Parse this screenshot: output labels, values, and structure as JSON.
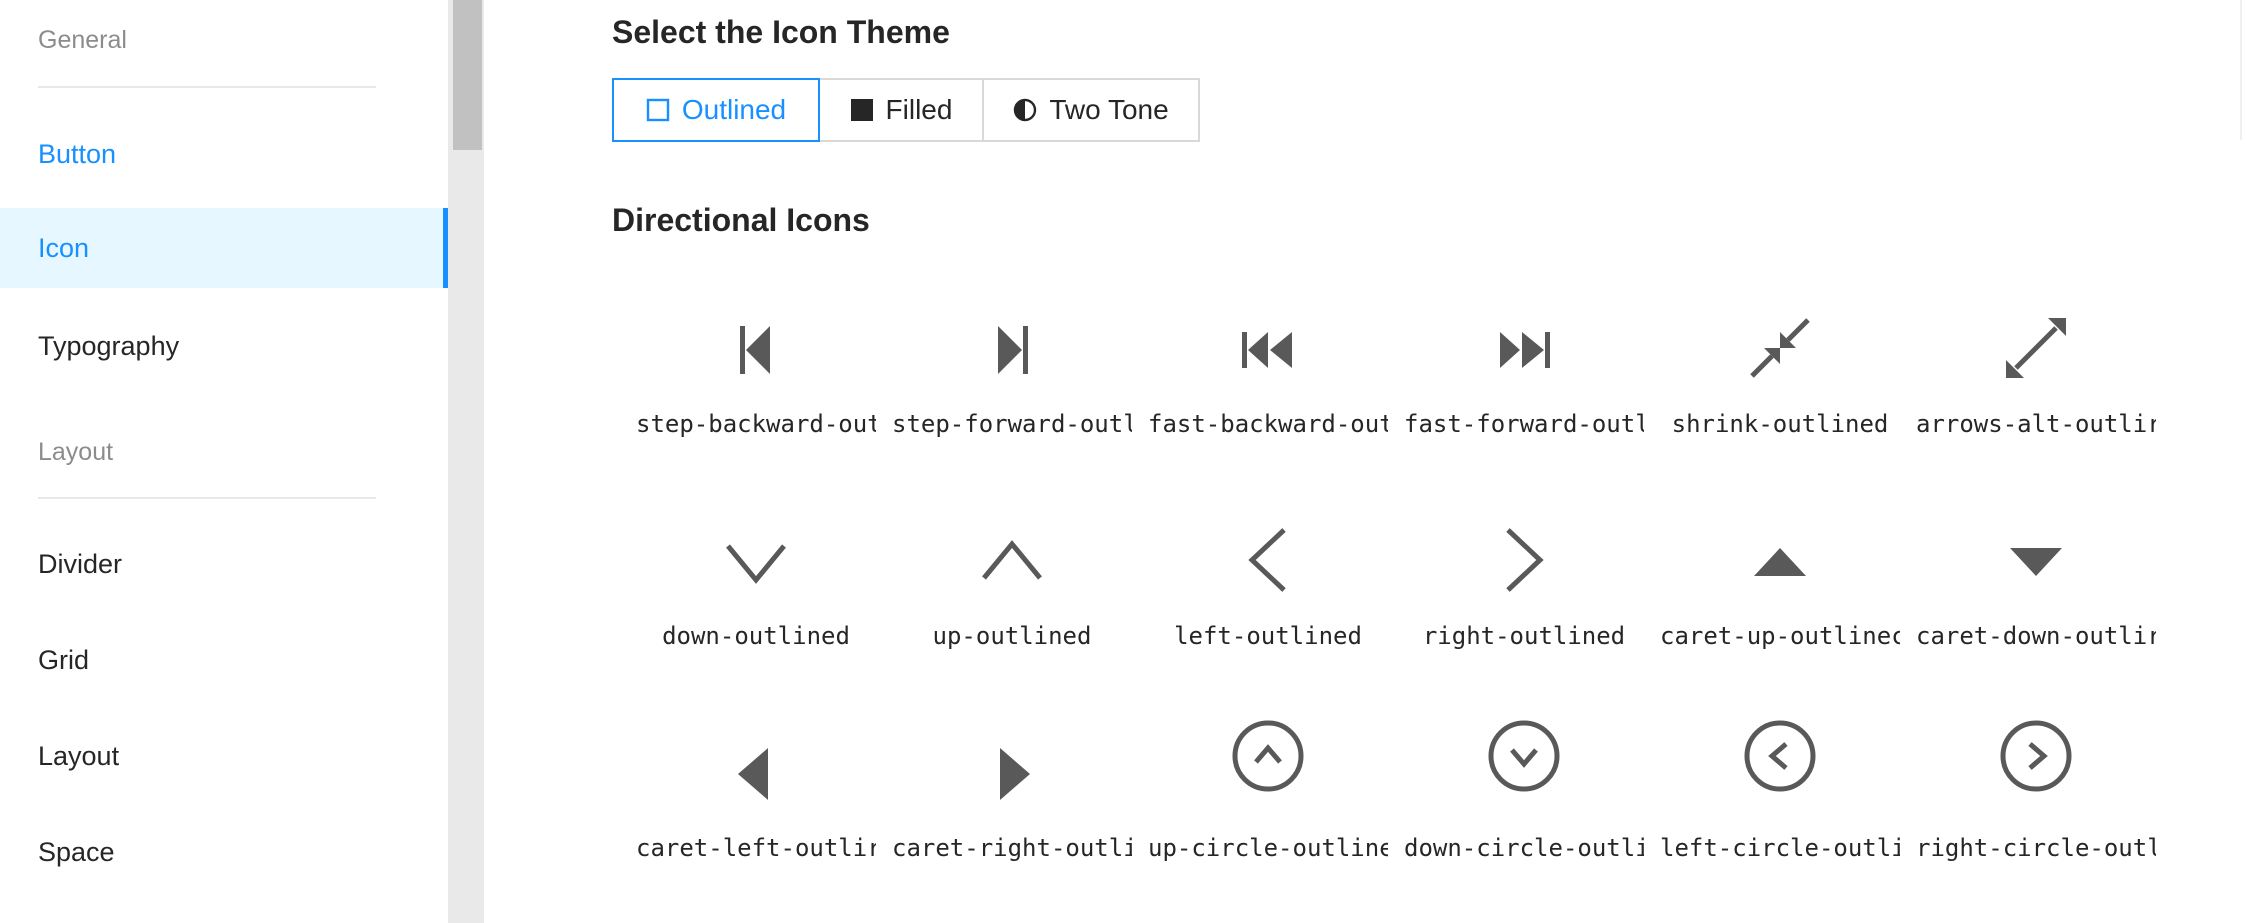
{
  "sidebar": {
    "group_general": "General",
    "item_button": "Button",
    "item_icon": "Icon",
    "item_typography": "Typography",
    "group_layout": "Layout",
    "item_divider": "Divider",
    "item_grid": "Grid",
    "item_layout": "Layout",
    "item_space": "Space"
  },
  "main": {
    "theme_title": "Select the Icon Theme",
    "theme_options": [
      "Outlined",
      "Filled",
      "Two Tone"
    ],
    "selected_theme": "Outlined",
    "section_title": "Directional Icons",
    "icons": [
      {
        "label": "step-backward-out",
        "icon": "step-backward-icon"
      },
      {
        "label": "step-forward-outl",
        "icon": "step-forward-icon"
      },
      {
        "label": "fast-backward-out",
        "icon": "fast-backward-icon"
      },
      {
        "label": "fast-forward-outl",
        "icon": "fast-forward-icon"
      },
      {
        "label": "shrink-outlined",
        "icon": "shrink-icon"
      },
      {
        "label": "arrows-alt-outlir",
        "icon": "arrows-alt-icon"
      },
      {
        "label": "down-outlined",
        "icon": "down-icon"
      },
      {
        "label": "up-outlined",
        "icon": "up-icon"
      },
      {
        "label": "left-outlined",
        "icon": "left-icon"
      },
      {
        "label": "right-outlined",
        "icon": "right-icon"
      },
      {
        "label": "caret-up-outlinec",
        "icon": "caret-up-icon"
      },
      {
        "label": "caret-down-outlir",
        "icon": "caret-down-icon"
      },
      {
        "label": "caret-left-outlir",
        "icon": "caret-left-icon"
      },
      {
        "label": "caret-right-outli",
        "icon": "caret-right-icon"
      },
      {
        "label": "up-circle-outline",
        "icon": "up-circle-icon"
      },
      {
        "label": "down-circle-outli",
        "icon": "down-circle-icon"
      },
      {
        "label": "left-circle-outli",
        "icon": "left-circle-icon"
      },
      {
        "label": "right-circle-outl",
        "icon": "right-circle-icon"
      }
    ]
  },
  "colors": {
    "accent": "#1890ff",
    "selected_bg": "#e6f7ff",
    "icon": "#595959"
  }
}
